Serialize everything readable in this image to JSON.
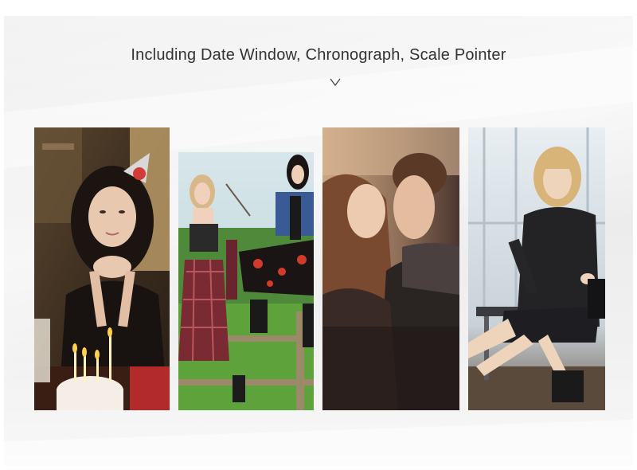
{
  "headline": "Including Date Window, Chronograph, Scale Pointer",
  "icons": {
    "chevron": "chevron-down-icon"
  },
  "photos": [
    {
      "name": "birthday-photo",
      "subject": "woman with birthday cake and party hat"
    },
    {
      "name": "friends-fence-photo",
      "subject": "two women by a fence in a field"
    },
    {
      "name": "couple-photo",
      "subject": "couple touching foreheads"
    },
    {
      "name": "fashion-photo",
      "subject": "woman in black dress seated"
    }
  ],
  "colors": {
    "background": "#ececec",
    "text": "#333333"
  }
}
